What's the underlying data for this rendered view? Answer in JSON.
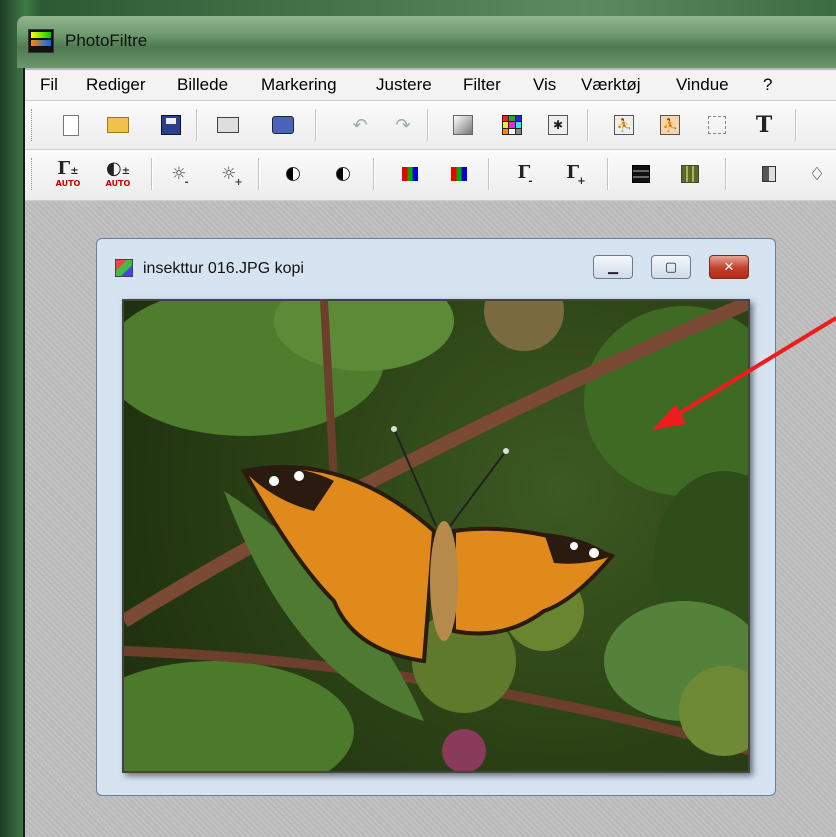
{
  "app": {
    "title": "PhotoFiltre"
  },
  "menu": {
    "items": [
      "Fil",
      "Rediger",
      "Billede",
      "Markering",
      "Justere",
      "Filter",
      "Vis",
      "Værktøj",
      "Vindue",
      "?"
    ]
  },
  "toolbar_row1": {
    "buttons": [
      "new-document",
      "open-file",
      "save",
      "print",
      "scan",
      "undo",
      "redo",
      "grayscale",
      "color-palette",
      "image-tool",
      "image-tool-2",
      "image-tool-3",
      "selection",
      "text"
    ],
    "text_button_label": "T"
  },
  "toolbar_row2": {
    "buttons": [
      "gamma-auto",
      "contrast-auto",
      "brightness-minus",
      "brightness-plus",
      "contrast-minus",
      "contrast-plus",
      "saturation-minus",
      "saturation-plus",
      "gamma-minus",
      "gamma-plus",
      "grid-dark",
      "grid-olive",
      "brush",
      "drop"
    ],
    "auto_label": "AUTO",
    "gamma_symbol": "Γ"
  },
  "document_window": {
    "title": "insekttur 016.JPG kopi",
    "image_subject": "butterfly on green leaves"
  },
  "colors": {
    "arrow": "#ee1c1c",
    "menubar": "#f3f3f3",
    "workspace": "#c0c0c0",
    "close_button": "#c2402a"
  }
}
